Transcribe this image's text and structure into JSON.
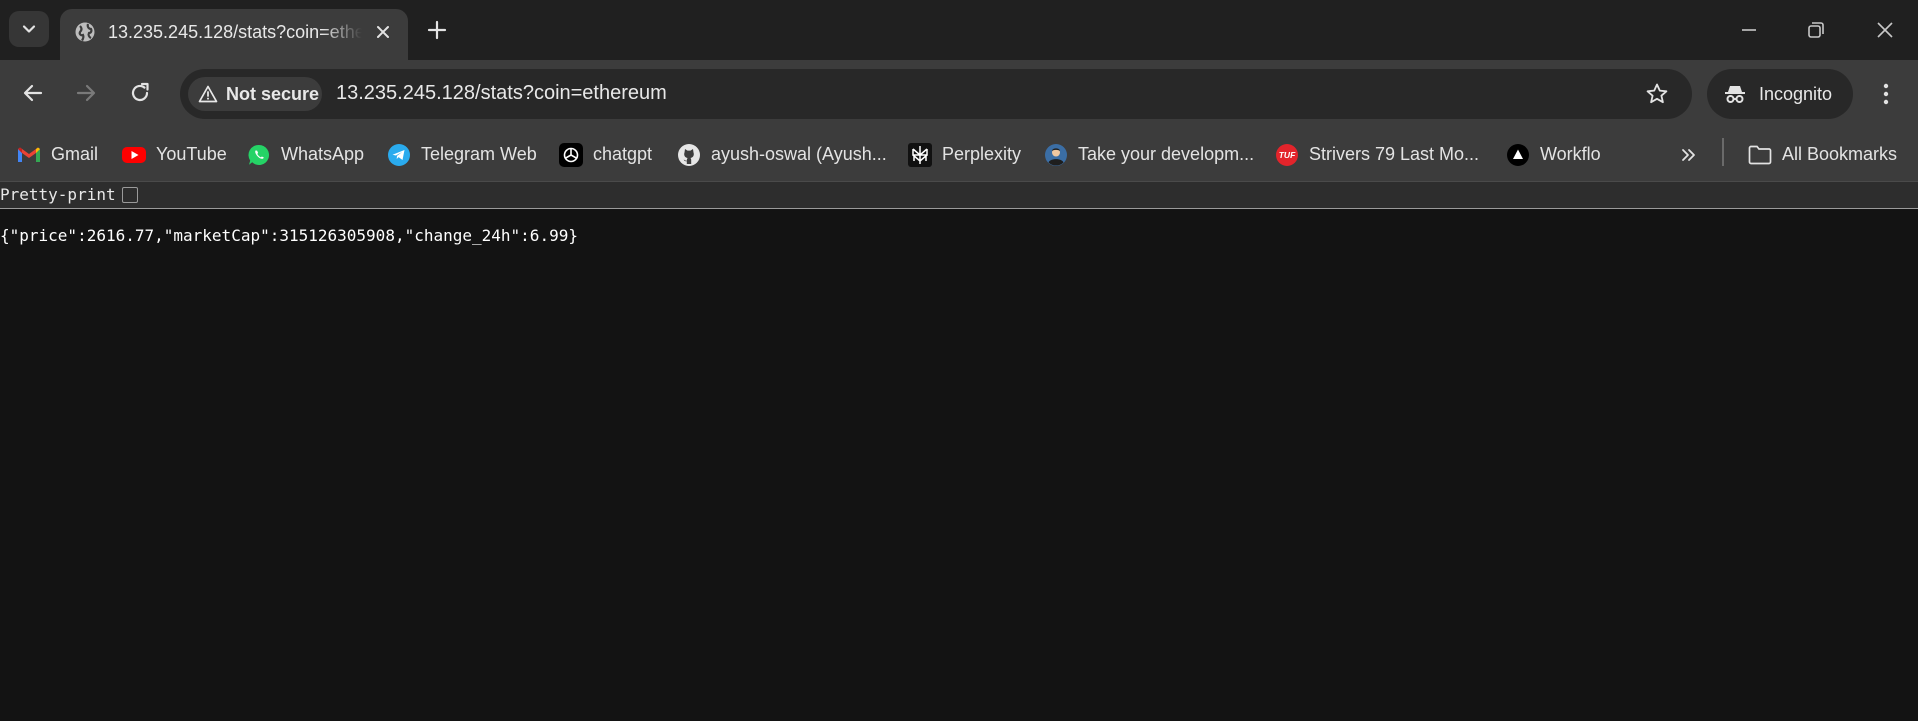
{
  "browser": {
    "tab": {
      "title": "13.235.245.128/stats?coin=ethereum"
    },
    "security_chip": "Not secure",
    "url": "13.235.245.128/stats?coin=ethereum",
    "profile": "Incognito",
    "bookmarks": [
      {
        "label": "Gmail",
        "icon": "gmail-icon"
      },
      {
        "label": "YouTube",
        "icon": "youtube-icon"
      },
      {
        "label": "WhatsApp",
        "icon": "whatsapp-icon"
      },
      {
        "label": "Telegram Web",
        "icon": "telegram-icon"
      },
      {
        "label": "chatgpt",
        "icon": "chatgpt-icon"
      },
      {
        "label": "ayush-oswal (Ayush...",
        "icon": "github-icon"
      },
      {
        "label": "Perplexity",
        "icon": "perplexity-icon"
      },
      {
        "label": "Take your developm...",
        "icon": "avatar-icon"
      },
      {
        "label": "Strivers 79 Last Mo...",
        "icon": "tuf-icon"
      },
      {
        "label": "Workflo",
        "icon": "workflo-icon"
      }
    ],
    "all_bookmarks": "All Bookmarks",
    "tuf_badge": "TUF"
  },
  "page": {
    "pretty_print_label": "Pretty-print",
    "pretty_print_checked": false,
    "json_text": "{\"price\":2616.77,\"marketCap\":315126305908,\"change_24h\":6.99}"
  }
}
